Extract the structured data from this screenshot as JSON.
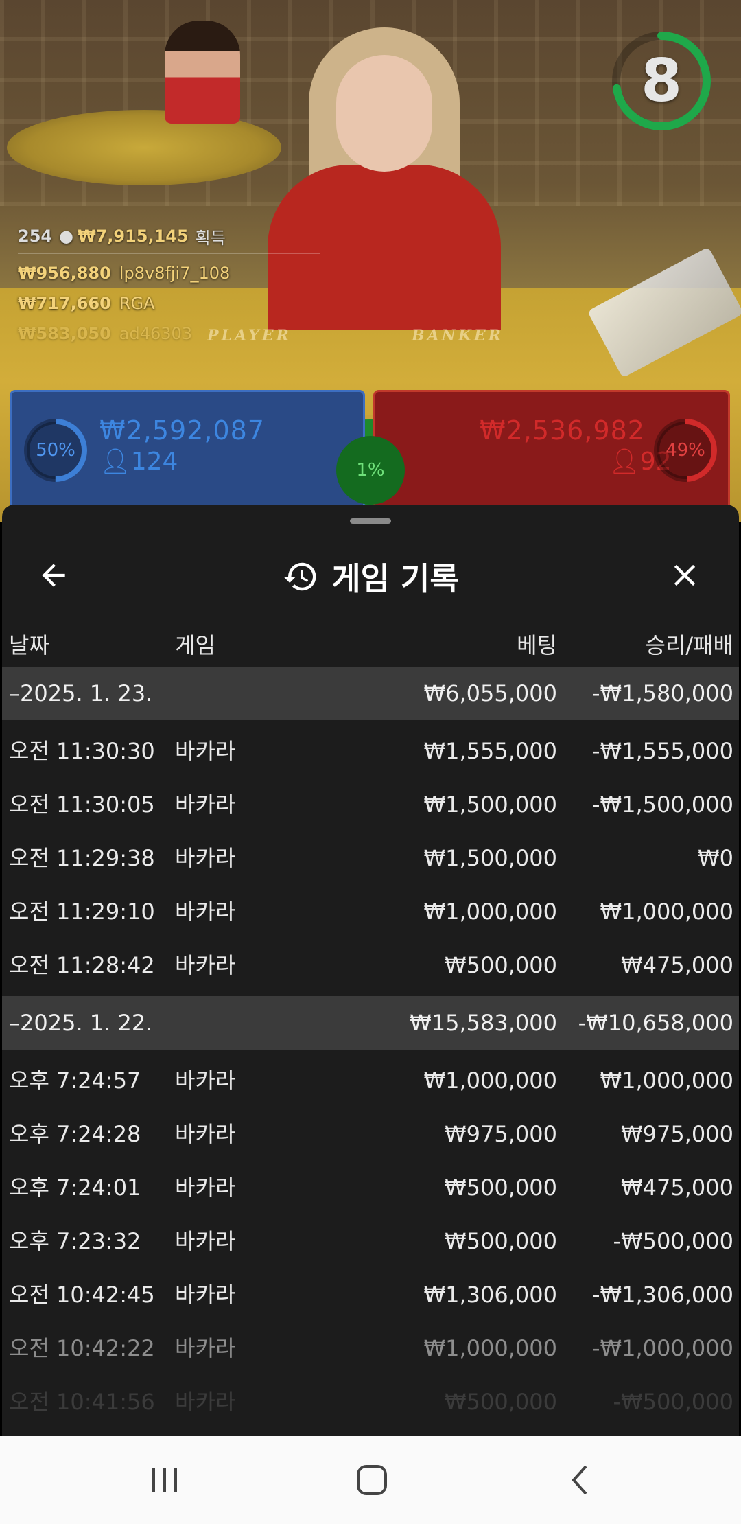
{
  "live": {
    "timer": "8",
    "ticker": {
      "count": "254",
      "total": "₩7,915,145",
      "total_suffix": "획득",
      "winners": [
        {
          "amount": "₩956,880",
          "name": "lp8v8fji7_108"
        },
        {
          "amount": "₩717,660",
          "name": "RGA"
        },
        {
          "amount": "₩583,050",
          "name": "ad46303"
        }
      ]
    },
    "table_labels": {
      "player": "PLAYER",
      "banker": "BANKER"
    },
    "player": {
      "percent_label": "50%",
      "percent": 50,
      "amount": "₩2,592,087",
      "count": "124",
      "color": "#3d7fd6"
    },
    "banker": {
      "percent_label": "49%",
      "percent": 49,
      "amount": "₩2,536,982",
      "count": "92",
      "color": "#d12a2a"
    },
    "tie": {
      "percent_label": "1%",
      "color": "#1f8a2c"
    }
  },
  "history": {
    "title": "게임 기록",
    "icons": {
      "back": "arrow-left-icon",
      "history": "history-clock-icon",
      "close": "close-x-icon"
    },
    "columns": {
      "date": "날짜",
      "game": "게임",
      "bet": "베팅",
      "result": "승리/패배"
    },
    "days": [
      {
        "date": "–2025. 1. 23.",
        "bet_total": "₩6,055,000",
        "result_total": "-₩1,580,000",
        "rows": [
          {
            "time": "오전 11:30:30",
            "game": "바카라",
            "bet": "₩1,555,000",
            "result": "-₩1,555,000"
          },
          {
            "time": "오전 11:30:05",
            "game": "바카라",
            "bet": "₩1,500,000",
            "result": "-₩1,500,000"
          },
          {
            "time": "오전 11:29:38",
            "game": "바카라",
            "bet": "₩1,500,000",
            "result": "₩0"
          },
          {
            "time": "오전 11:29:10",
            "game": "바카라",
            "bet": "₩1,000,000",
            "result": "₩1,000,000"
          },
          {
            "time": "오전 11:28:42",
            "game": "바카라",
            "bet": "₩500,000",
            "result": "₩475,000"
          }
        ]
      },
      {
        "date": "–2025. 1. 22.",
        "bet_total": "₩15,583,000",
        "result_total": "-₩10,658,000",
        "rows": [
          {
            "time": "오후 7:24:57",
            "game": "바카라",
            "bet": "₩1,000,000",
            "result": "₩1,000,000"
          },
          {
            "time": "오후 7:24:28",
            "game": "바카라",
            "bet": "₩975,000",
            "result": "₩975,000"
          },
          {
            "time": "오후 7:24:01",
            "game": "바카라",
            "bet": "₩500,000",
            "result": "₩475,000"
          },
          {
            "time": "오후 7:23:32",
            "game": "바카라",
            "bet": "₩500,000",
            "result": "-₩500,000"
          },
          {
            "time": "오전 10:42:45",
            "game": "바카라",
            "bet": "₩1,306,000",
            "result": "-₩1,306,000"
          },
          {
            "time": "오전 10:42:22",
            "game": "바카라",
            "bet": "₩1,000,000",
            "result": "-₩1,000,000"
          },
          {
            "time": "오전 10:41:56",
            "game": "바카라",
            "bet": "₩500,000",
            "result": "-₩500,000"
          }
        ]
      }
    ]
  },
  "navbar": {
    "icons": [
      "recent-apps-icon",
      "home-icon",
      "back-chevron-icon"
    ]
  }
}
